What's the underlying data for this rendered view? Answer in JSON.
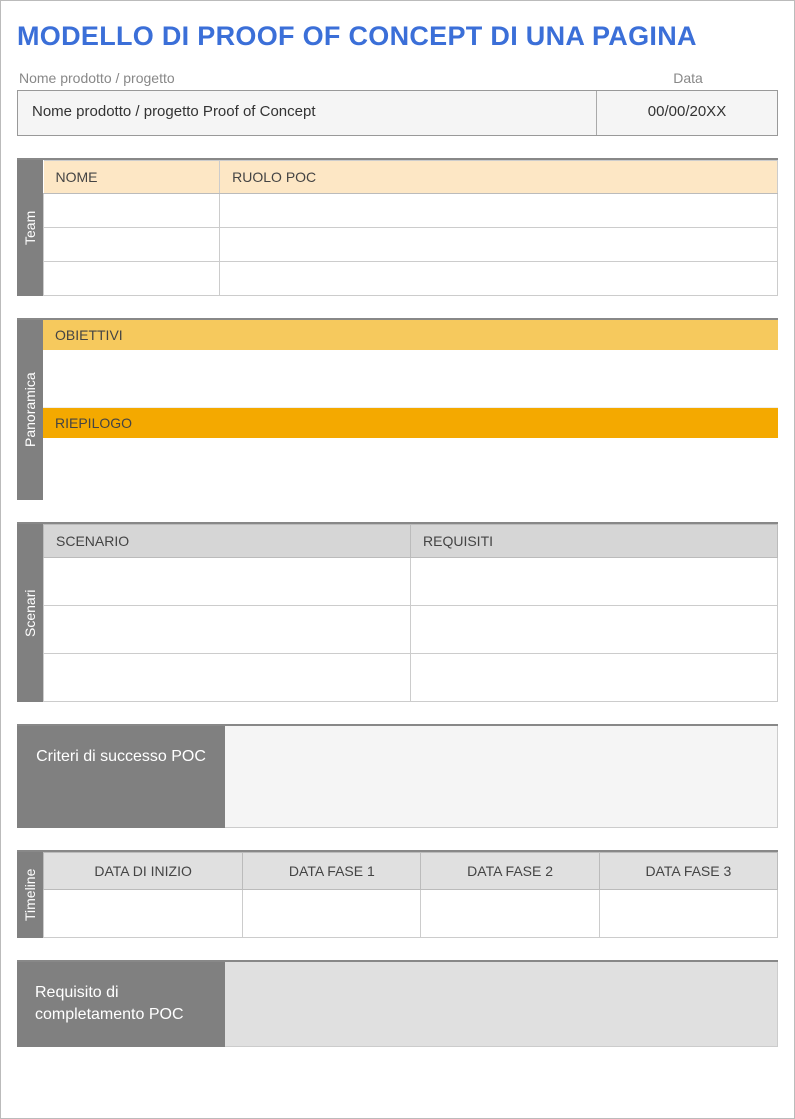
{
  "title": "MODELLO DI PROOF OF CONCEPT DI UNA PAGINA",
  "meta": {
    "name_label": "Nome prodotto / progetto",
    "date_label": "Data",
    "name_value": "Nome prodotto / progetto Proof of Concept",
    "date_value": "00/00/20XX"
  },
  "sections": {
    "team": {
      "label": "Team",
      "col_name": "NOME",
      "col_role": "RUOLO POC",
      "rows": [
        {
          "name": "",
          "role": ""
        },
        {
          "name": "",
          "role": ""
        },
        {
          "name": "",
          "role": ""
        }
      ]
    },
    "panoramica": {
      "label": "Panoramica",
      "obiettivi_label": "OBIETTIVI",
      "obiettivi_value": "",
      "riepilogo_label": "RIEPILOGO",
      "riepilogo_value": ""
    },
    "scenari": {
      "label": "Scenari",
      "col_scenario": "SCENARIO",
      "col_requisiti": "REQUISITI",
      "rows": [
        {
          "s": "",
          "r": ""
        },
        {
          "s": "",
          "r": ""
        },
        {
          "s": "",
          "r": ""
        }
      ]
    },
    "criteri": {
      "label": "Criteri di successo POC",
      "value": ""
    },
    "timeline": {
      "label": "Timeline",
      "headers": [
        "DATA DI INIZIO",
        "DATA FASE 1",
        "DATA FASE 2",
        "DATA FASE 3"
      ],
      "values": [
        "",
        "",
        "",
        ""
      ]
    },
    "completamento": {
      "label": "Requisito di completamento POC",
      "value": ""
    }
  }
}
